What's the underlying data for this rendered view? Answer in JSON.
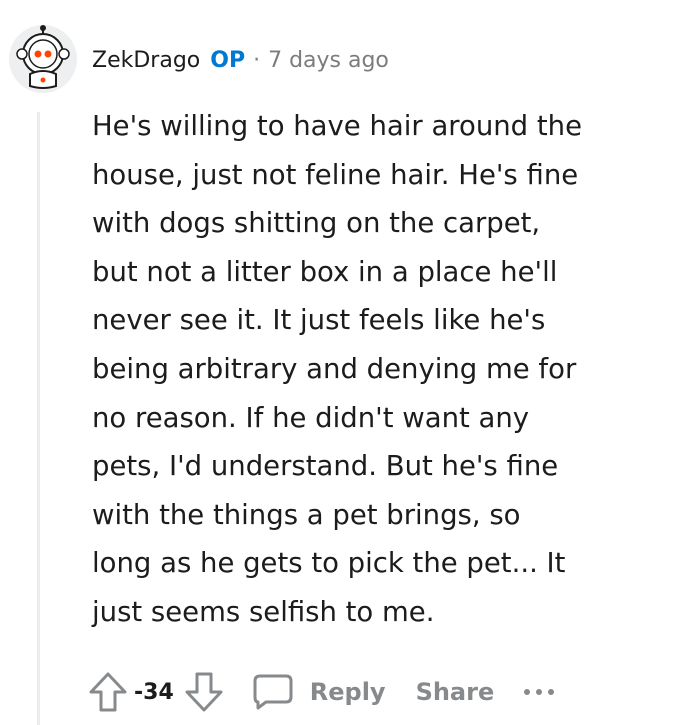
{
  "comment": {
    "author": "ZekDrago",
    "op_badge": "OP",
    "separator": "·",
    "timestamp": "7 days ago",
    "avatar_icon": "snoo-astronaut-avatar-icon",
    "body": "He's willing to have hair around the\nhouse, just not feline hair. He's fine\nwith dogs shitting on the carpet,\nbut not a litter box in a place he'll\nnever see it. It just feels like he's\nbeing arbitrary and denying me for\nno reason. If he didn't want any\npets, I'd understand. But he's fine\nwith the things a pet brings, so\nlong as he gets to pick the pet... It\njust seems selfish to me.",
    "score": "-34"
  },
  "actions": {
    "upvote_icon": "arrow-up-icon",
    "downvote_icon": "arrow-down-icon",
    "reply_icon": "speech-bubble-icon",
    "reply_label": "Reply",
    "share_label": "Share",
    "more_icon": "more-horizontal-icon"
  },
  "colors": {
    "op_blue": "#0079d3",
    "meta_gray": "#7c7c7c",
    "action_gray": "#878a8c",
    "text": "#1c1c1c",
    "thread_line": "#ececec"
  }
}
